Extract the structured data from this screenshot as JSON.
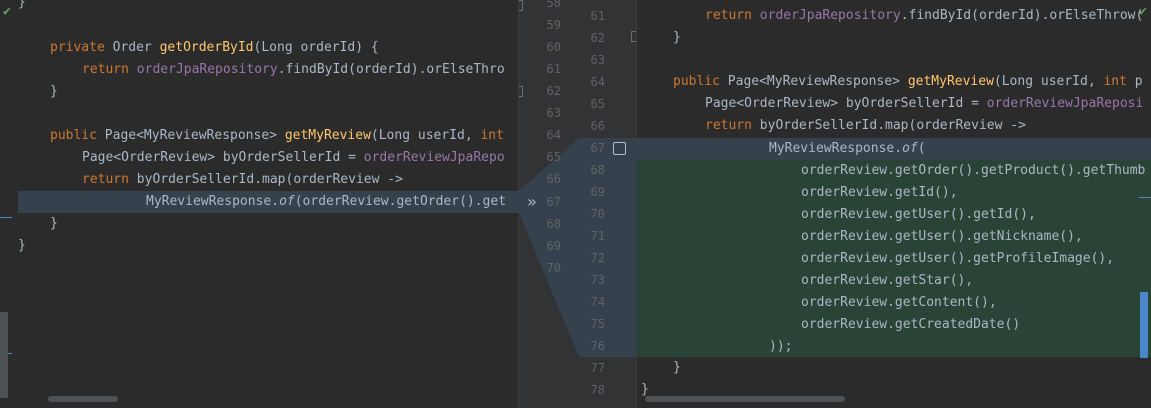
{
  "left": {
    "lines": [
      {
        "id": "l0",
        "text": "}"
      },
      {
        "id": "l1a",
        "kw": "private",
        "type": " Order ",
        "fn": "getOrderById",
        "rest": "(Long orderId) {"
      },
      {
        "id": "l2a",
        "kw": "return",
        "field": " orderJpaRepository",
        "rest": ".findById(orderId).orElseThro"
      },
      {
        "id": "l3",
        "text": "}"
      },
      {
        "id": "l5a",
        "kw": "public",
        "type": " Page<MyReviewResponse> ",
        "fn": "getMyReview",
        "rest": "(Long userId, ",
        "kw2": "int"
      },
      {
        "id": "l6a",
        "type": "Page<OrderReview> byOrderSellerId = ",
        "field": "orderReviewJpaRepo"
      },
      {
        "id": "l7a",
        "kw": "return",
        "rest": " byOrderSellerId.map(orderReview ->"
      },
      {
        "id": "l8a",
        "pre": "MyReviewResponse.",
        "it": "of",
        "rest": "(orderReview.getOrder().get"
      },
      {
        "id": "l9",
        "text": "}"
      },
      {
        "id": "l10",
        "text": "}"
      }
    ]
  },
  "center": {
    "left_numbers": [
      "58",
      "59",
      "60",
      "61",
      "62",
      "63",
      "64",
      "65",
      "66",
      "67",
      "68",
      "69",
      "70"
    ],
    "right_numbers": [
      "61",
      "62",
      "63",
      "64",
      "65",
      "66",
      "67",
      "68",
      "69",
      "70",
      "71",
      "72",
      "73",
      "74",
      "75",
      "76",
      "77",
      "78"
    ]
  },
  "right": {
    "lines": [
      {
        "id": "r61",
        "kw": "return",
        "field": " orderJpaRepository",
        "rest": ".findById(orderId).orElseThrow("
      },
      {
        "id": "r62",
        "text": "}"
      },
      {
        "id": "r64",
        "kw": "public",
        "type": " Page<MyReviewResponse> ",
        "fn": "getMyReview",
        "rest": "(Long userId, ",
        "kw2": "int",
        "rest2": " p"
      },
      {
        "id": "r65",
        "type": "Page<OrderReview> byOrderSellerId = ",
        "field": "orderReviewJpaReposi"
      },
      {
        "id": "r66",
        "kw": "return",
        "rest": " byOrderSellerId.map(orderReview ->"
      },
      {
        "id": "r67",
        "pre": "MyReviewResponse.",
        "it": "of",
        "rest": "("
      },
      {
        "id": "r68",
        "text": "orderReview.getOrder().getProduct().getThumb"
      },
      {
        "id": "r69",
        "text": "orderReview.getId(),"
      },
      {
        "id": "r70",
        "text": "orderReview.getUser().getId(),"
      },
      {
        "id": "r71",
        "text": "orderReview.getUser().getNickname(),"
      },
      {
        "id": "r72",
        "text": "orderReview.getUser().getProfileImage(),"
      },
      {
        "id": "r73",
        "text": "orderReview.getStar(),"
      },
      {
        "id": "r74",
        "text": "orderReview.getContent(),"
      },
      {
        "id": "r75",
        "text": "orderReview.getCreatedDate()"
      },
      {
        "id": "r76",
        "text": "));"
      },
      {
        "id": "r77",
        "text": "}"
      },
      {
        "id": "r78",
        "text": "}"
      }
    ]
  },
  "icons": {
    "check": "check-icon",
    "fold": "fold-icon",
    "apply": "double-chevron-right-icon",
    "select": "checkbox-icon"
  },
  "colors": {
    "background": "#2b2b2b",
    "changed": "#36414e",
    "added": "#294436",
    "keyword": "#cc7832",
    "function": "#ffc66d",
    "field": "#9876aa",
    "text": "#a9b7c6"
  }
}
